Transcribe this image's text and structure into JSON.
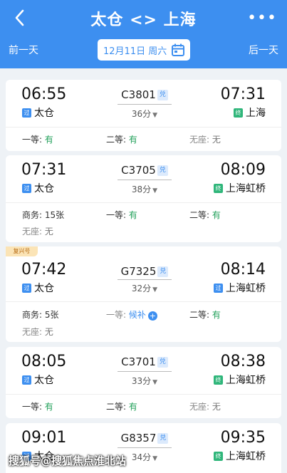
{
  "header": {
    "title": "太仓 <> 上海",
    "more": "•••",
    "prev_day": "前一天",
    "next_day": "后一天",
    "date": "12月11日 周六"
  },
  "labels": {
    "first": "一等:",
    "second": "二等:",
    "nosit": "无座:",
    "business": "商务:",
    "pass": "过",
    "term": "终",
    "dui": "兑",
    "caret": "▼",
    "plus": "+"
  },
  "fuxing_label": "复兴号",
  "trains": [
    {
      "dep_time": "06:55",
      "dep_station": "太仓",
      "train_no": "C3801",
      "duration": "36分",
      "arr_time": "07:31",
      "arr_station": "上海",
      "first": "有",
      "second": "有",
      "nosit": "无"
    },
    {
      "dep_time": "07:31",
      "dep_station": "太仓",
      "train_no": "C3705",
      "duration": "38分",
      "arr_time": "08:09",
      "arr_station": "上海虹桥",
      "business": "15张",
      "first": "有",
      "second": "有",
      "nosit": "无"
    },
    {
      "dep_time": "07:42",
      "dep_station": "太仓",
      "train_no": "G7325",
      "duration": "32分",
      "arr_time": "08:14",
      "arr_station": "上海虹桥",
      "business": "5张",
      "first": "候补",
      "second": "有",
      "nosit": "无"
    },
    {
      "dep_time": "08:05",
      "dep_station": "太仓",
      "train_no": "C3701",
      "duration": "33分",
      "arr_time": "08:38",
      "arr_station": "上海虹桥",
      "first": "有",
      "second": "有",
      "nosit": "无"
    },
    {
      "dep_time": "09:01",
      "dep_station": "太仓",
      "train_no": "G8357",
      "duration": "34分",
      "arr_time": "09:35",
      "arr_station": "上海虹桥"
    }
  ],
  "watermark": "搜狐号@搜狐焦点淮北站",
  "colors": {
    "header": "#3d8ff0",
    "available": "#22a05a",
    "accent": "#3d8ff0"
  }
}
